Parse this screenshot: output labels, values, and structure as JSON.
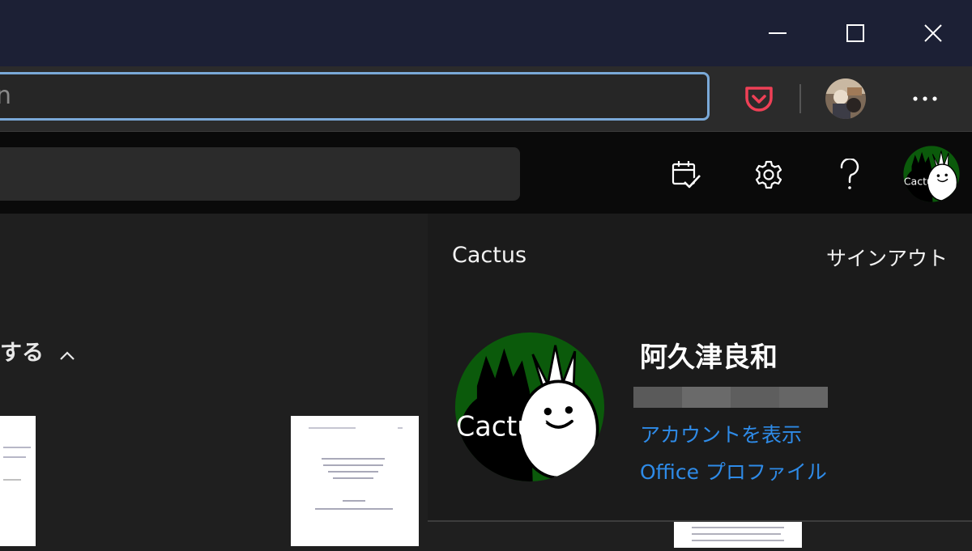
{
  "titlebar": {
    "minimize_icon": "minimize-icon",
    "maximize_icon": "maximize-icon",
    "close_icon": "close-icon"
  },
  "toolbar": {
    "address_text": "n",
    "pocket_icon": "pocket-icon",
    "more_icon": "more-horizontal-icon",
    "accent_color": "#7aa9d8",
    "pocket_color": "#ef4056"
  },
  "appbar": {
    "calendar_icon": "calendar-check-icon",
    "settings_icon": "gear-icon",
    "help_icon": "question-icon"
  },
  "main": {
    "section_title": "する"
  },
  "account_panel": {
    "org_name": "Cactus",
    "sign_out": "サインアウト",
    "user_name": "阿久津良和",
    "view_account": "アカウントを表示",
    "office_profile": "Office プロファイル",
    "avatar_text": "Cactus",
    "link_color": "#2e8be8"
  }
}
